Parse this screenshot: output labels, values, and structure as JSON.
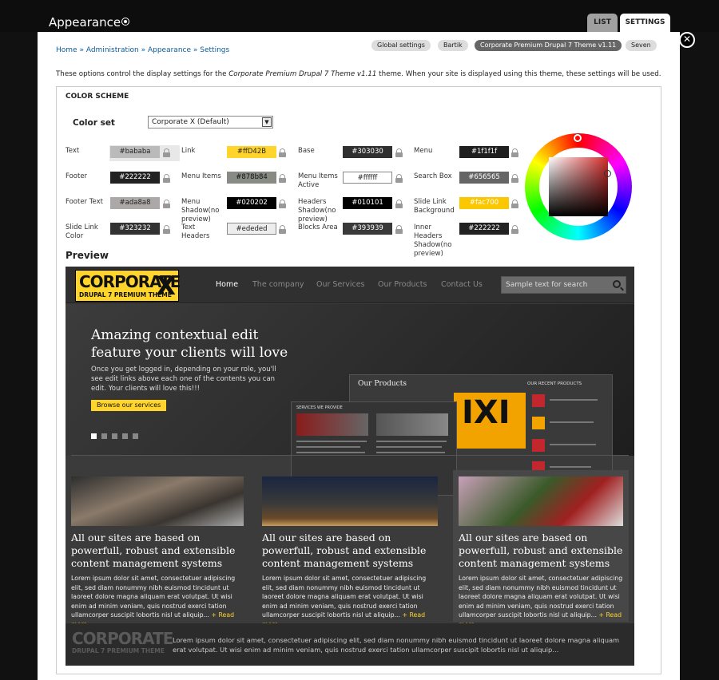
{
  "window": {
    "title": "Appearance",
    "tabs": [
      "LIST",
      "SETTINGS"
    ],
    "active_tab": "SETTINGS"
  },
  "breadcrumb": [
    "Home",
    "Administration",
    "Appearance",
    "Settings"
  ],
  "breadcrumb_separator": "»",
  "secondary_tabs": [
    "Global settings",
    "Bartik",
    "Corporate Premium Drupal 7 Theme v1.11",
    "Seven"
  ],
  "description": {
    "before": "These options control the display settings for the ",
    "theme_name": "Corporate Premium Drupal 7 Theme v1.11",
    "after": " theme. When your site is displayed using this theme, these settings will be used."
  },
  "color_scheme": {
    "legend": "COLOR SCHEME",
    "color_set_label": "Color set",
    "color_set_value": "Corporate X (Default)",
    "fields": [
      {
        "label": "Text",
        "value": "#bababa",
        "color": "#bababa",
        "text_color": "#222222"
      },
      {
        "label": "Link",
        "value": "#ffD42B",
        "color": "#ffd42b",
        "text_color": "#222222"
      },
      {
        "label": "Base",
        "value": "#303030",
        "color": "#303030",
        "text_color": "#ffffff"
      },
      {
        "label": "Menu",
        "value": "#1f1f1f",
        "color": "#1f1f1f",
        "text_color": "#ffffff"
      },
      {
        "label": "Footer",
        "value": "#222222",
        "color": "#222222",
        "text_color": "#ffffff"
      },
      {
        "label": "Menu Items",
        "value": "#878b84",
        "color": "#878b84",
        "text_color": "#111111"
      },
      {
        "label": "Menu Items Active",
        "value": "#ffffff",
        "color": "#ffffff",
        "text_color": "#222222"
      },
      {
        "label": "Search Box",
        "value": "#656565",
        "color": "#656565",
        "text_color": "#ffffff"
      },
      {
        "label": "Footer Text",
        "value": "#ada8a8",
        "color": "#ada8a8",
        "text_color": "#222222"
      },
      {
        "label": "Menu Shadow(no preview)",
        "value": "#020202",
        "color": "#020202",
        "text_color": "#ffffff"
      },
      {
        "label": "Headers Shadow(no preview)",
        "value": "#010101",
        "color": "#010101",
        "text_color": "#ffffff"
      },
      {
        "label": "Slide Link Background",
        "value": "#fac700",
        "color": "#fac700",
        "text_color": "#ffffff"
      },
      {
        "label": "Slide Link Color",
        "value": "#323232",
        "color": "#323232",
        "text_color": "#ffffff"
      },
      {
        "label": "Text Headers",
        "value": "#ededed",
        "color": "#ededed",
        "text_color": "#222222"
      },
      {
        "label": "Blocks Area",
        "value": "#393939",
        "color": "#393939",
        "text_color": "#ffffff"
      },
      {
        "label": "Inner Headers Shadow(no preview)",
        "value": "#222222",
        "color": "#222222",
        "text_color": "#ffffff"
      }
    ]
  },
  "preview": {
    "label": "Preview",
    "logo": {
      "main": "CORPORATE",
      "x": "X",
      "sub": "DRUPAL 7 PREMIUM THEME"
    },
    "nav": [
      "Home",
      "The company",
      "Our Services",
      "Our Products",
      "Contact Us"
    ],
    "search_placeholder": "Sample text for search",
    "hero": {
      "title": "Amazing contextual edit feature your clients will love",
      "text": "Once you get logged in, depending on your role, you'll see edit links above each one of the contents you can edit. Your clients will love this!!!",
      "button": "Browse our services"
    },
    "shot_back": {
      "title": "Our Products",
      "right_heading": "OUR RECENT PRODUCTS",
      "big_letters": "IXI"
    },
    "shot_front": {
      "title": "SERVICES WE PROVIDE"
    },
    "cards": [
      {
        "title": "All our sites are based on powerfull, robust and extensible content management systems",
        "text": "Lorem ipsum dolor sit amet, consectetuer adipiscing elit, sed diam nonummy nibh euismod tincidunt ut laoreet dolore magna aliquam erat volutpat. Ut wisi enim ad minim veniam, quis nostrud exerci tation ullamcorper suscipit lobortis nisl ut aliquip...",
        "more": "+ Read more"
      },
      {
        "title": "All our sites are based on powerfull, robust and extensible content management systems",
        "text": "Lorem ipsum dolor sit amet, consectetuer adipiscing elit, sed diam nonummy nibh euismod tincidunt ut laoreet dolore magna aliquam erat volutpat. Ut wisi enim ad minim veniam, quis nostrud exerci tation ullamcorper suscipit lobortis nisl ut aliquip...",
        "more": "+ Read more"
      },
      {
        "title": "All our sites are based on powerfull, robust and extensible content management systems",
        "text": "Lorem ipsum dolor sit amet, consectetuer adipiscing elit, sed diam nonummy nibh euismod tincidunt ut laoreet dolore magna aliquam erat volutpat. Ut wisi enim ad minim veniam, quis nostrud exerci tation ullamcorper suscipit lobortis nisl ut aliquip...",
        "more": "+ Read more"
      }
    ],
    "footer": {
      "logo": "CORPORATE",
      "sub": "DRUPAL 7 PREMIUM THEME",
      "text": "Lorem ipsum dolor sit amet, consectetuer adipiscing elit, sed diam nonummy nibh euismod tincidunt ut laoreet dolore magna aliquam erat volutpat. Ut wisi enim ad minim veniam, quis nostrud exerci tation ullamcorper suscipit lobortis nisl ut aliquip..."
    }
  },
  "icons": {
    "close": "close-icon",
    "lock": "lock-icon",
    "search": "search-icon",
    "settings": "settings-circle-icon"
  },
  "colors": {
    "accent": "#ffd42b",
    "link": "#0a5c99",
    "preview_bg": "#3b3b3b"
  }
}
